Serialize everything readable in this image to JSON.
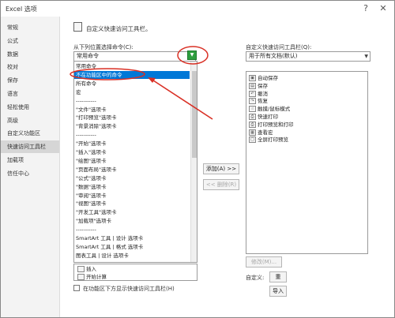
{
  "window": {
    "title": "Excel 选项",
    "help_glyph": "?",
    "close_glyph": "✕"
  },
  "nav": {
    "items": [
      "常规",
      "公式",
      "数据",
      "校对",
      "保存",
      "语言",
      "轻松使用",
      "高级",
      "自定义功能区",
      "快速访问工具栏",
      "加载项",
      "信任中心"
    ],
    "selected_index": 9
  },
  "header": {
    "text": "自定义快速访问工具栏。"
  },
  "left": {
    "choose_label": "从下列位置选择命令(C):",
    "choose_value": "常用命令",
    "dropdown_options": [
      "常用命令",
      "不在功能区中的命令",
      "所有命令",
      "宏",
      "-----------",
      "\"文件\"选项卡",
      "\"打印预览\"选项卡",
      "\"背景消除\"选项卡",
      "-----------",
      "\"开始\"选项卡",
      "\"插入\"选项卡",
      "\"绘图\"选项卡",
      "\"页面布局\"选项卡",
      "\"公式\"选项卡",
      "\"数据\"选项卡",
      "\"审阅\"选项卡",
      "\"视图\"选项卡",
      "\"开发工具\"选项卡",
      "\"加载项\"选项卡",
      "-----------",
      "SmartArt 工具 | 设计 选项卡",
      "SmartArt 工具 | 格式 选项卡",
      "图表工具 | 设计 选项卡"
    ],
    "highlight_index": 1,
    "list_tail": [
      "插入",
      "开始计算"
    ],
    "checkbox_label": "在功能区下方显示快速访问工具栏(H)"
  },
  "middle": {
    "add_label": "添加(A) >>",
    "remove_label": "<< 删除(R)"
  },
  "right": {
    "label": "自定义快速访问工具栏(Q):",
    "value": "用于所有文档(默认)",
    "items": [
      "自动保存",
      "保存",
      "撤消",
      "恢复",
      "触摸/鼠标模式",
      "快速打印",
      "打印预览和打印",
      "查看宏",
      "全屏打印预览"
    ],
    "icons": [
      "▣",
      "▤",
      "↶",
      "↷",
      "☝",
      "⎙",
      "⎙",
      "▦",
      "▢"
    ],
    "modify_label": "修改(M)...",
    "customize_label": "自定义:",
    "reset_label": "重",
    "import_label": "导入"
  },
  "colors": {
    "highlight_bg": "#0078d7",
    "annotation_red": "#d93025",
    "dropdown_btn": "#2e9e3f"
  }
}
